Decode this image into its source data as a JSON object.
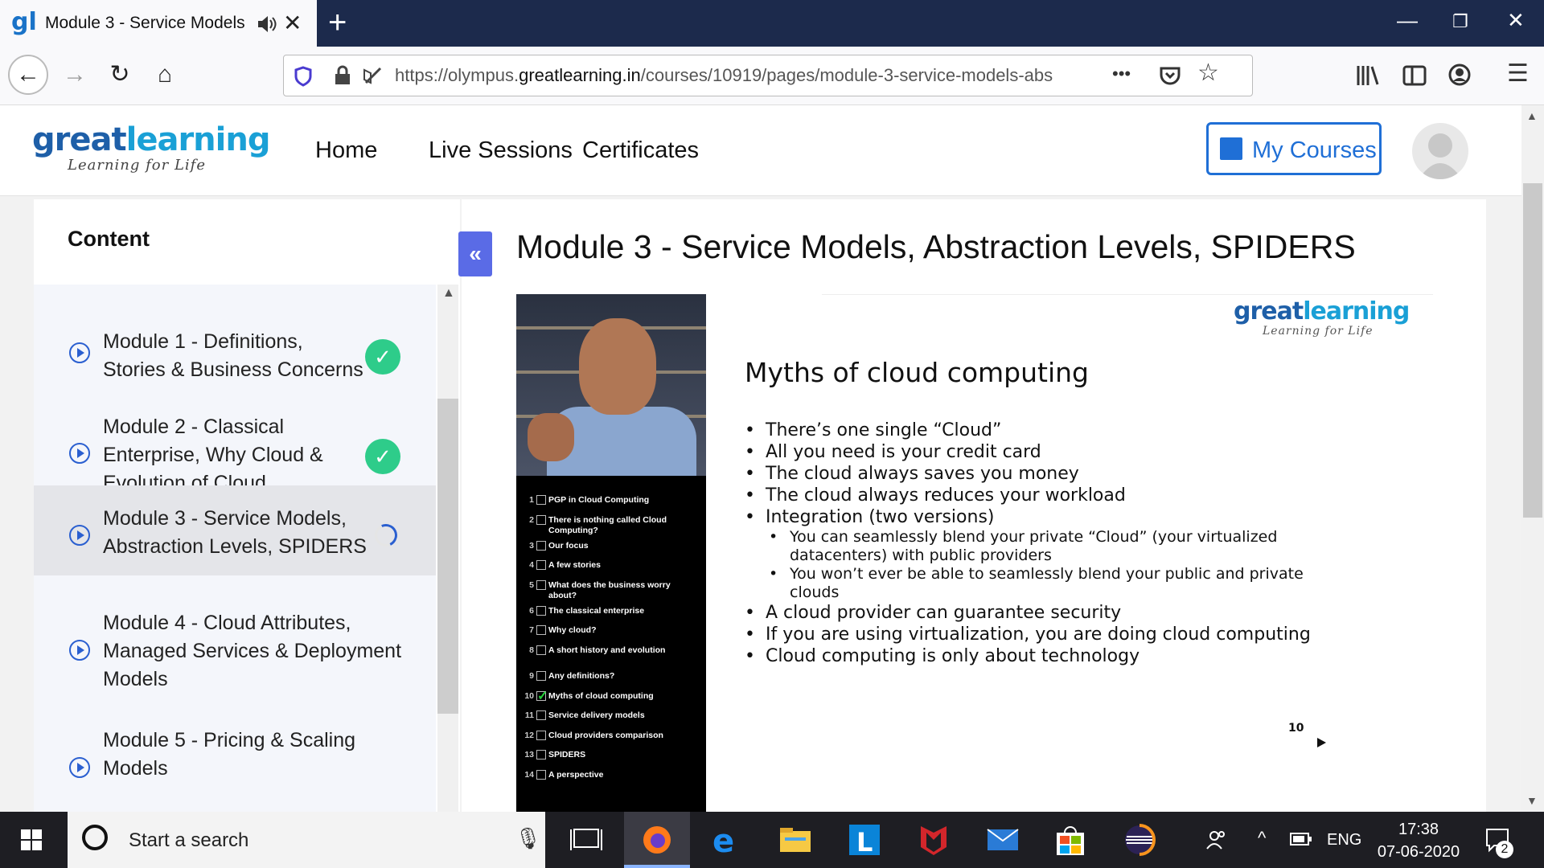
{
  "browser": {
    "tab_title": "Module 3 - Service Models,",
    "url_prefix": "https://olympus.",
    "url_domain": "greatlearning.in",
    "url_path": "/courses/10919/pages/module-3-service-models-abs",
    "url_more": "•••"
  },
  "header": {
    "logo_main_a": "great",
    "logo_main_b": "learning",
    "logo_tagline": "Learning for Life",
    "nav": [
      "Home",
      "Live Sessions",
      "Certificates"
    ],
    "my_courses": "My Courses"
  },
  "sidebar": {
    "title": "Content",
    "modules": [
      {
        "lines": [
          "Module 1 - Definitions,",
          "Stories & Business Concerns"
        ],
        "status": "complete"
      },
      {
        "lines": [
          "Module 2 - Classical",
          "Enterprise, Why Cloud &",
          "Evolution of Cloud"
        ],
        "status": "complete"
      },
      {
        "lines": [
          "Module 3 - Service Models,",
          "Abstraction Levels, SPIDERS"
        ],
        "status": "in-progress"
      },
      {
        "lines": [
          "Module 4 - Cloud Attributes,",
          "Managed Services & Deployment",
          "Models"
        ],
        "status": "none"
      },
      {
        "lines": [
          "Module 5 - Pricing & Scaling",
          "Models"
        ],
        "status": "none"
      }
    ],
    "collapse_glyph": "«"
  },
  "main": {
    "title": "Module 3 - Service Models, Abstraction Levels, SPIDERS"
  },
  "slide": {
    "logo_a": "great",
    "logo_b": "learning",
    "logo_tagline": "Learning for Life",
    "heading": "Myths of cloud computing",
    "bullets": [
      "There’s one single “Cloud”",
      "All you need is your credit card",
      "The cloud always saves you money",
      "The cloud always reduces your workload",
      "Integration (two versions)"
    ],
    "sub_bullets": [
      "You can seamlessly blend your private “Cloud” (your virtualized datacenters) with public providers",
      "You won’t ever be able to seamlessly blend your public and private clouds"
    ],
    "bullets_after": [
      "A cloud provider can guarantee security",
      "If you are using virtualization, you are doing cloud computing",
      "Cloud computing is only about technology"
    ],
    "slide_number": "10",
    "agenda": [
      {
        "n": "1",
        "t": "PGP in Cloud Computing",
        "checked": false
      },
      {
        "n": "2",
        "t": "There is nothing called Cloud Computing?",
        "checked": false
      },
      {
        "n": "3",
        "t": "Our focus",
        "checked": false
      },
      {
        "n": "4",
        "t": "A few stories",
        "checked": false
      },
      {
        "n": "5",
        "t": "What does the business worry about?",
        "checked": false
      },
      {
        "n": "6",
        "t": "The classical enterprise",
        "checked": false
      },
      {
        "n": "7",
        "t": "Why cloud?",
        "checked": false
      },
      {
        "n": "8",
        "t": "A short history and evolution",
        "checked": false
      },
      {
        "n": "9",
        "t": "Any definitions?",
        "checked": false
      },
      {
        "n": "10",
        "t": "Myths of cloud computing",
        "checked": true
      },
      {
        "n": "11",
        "t": "Service delivery models",
        "checked": false
      },
      {
        "n": "12",
        "t": "Cloud providers comparison",
        "checked": false
      },
      {
        "n": "13",
        "t": "SPIDERS",
        "checked": false
      },
      {
        "n": "14",
        "t": "A perspective",
        "checked": false
      }
    ]
  },
  "taskbar": {
    "search_placeholder": "Start a search",
    "lang": "ENG",
    "time": "17:38",
    "date": "07-06-2020",
    "notif_count": "2",
    "apps": [
      "task-view-icon",
      "firefox-icon",
      "edge-icon",
      "file-explorer-icon",
      "l-app-icon",
      "mcafee-icon",
      "mail-icon",
      "store-icon",
      "eclipse-icon"
    ]
  },
  "colors": {
    "brand_blue": "#1f6fd6",
    "check_green": "#2ecc8a",
    "collapse_purple": "#5a6be6"
  }
}
